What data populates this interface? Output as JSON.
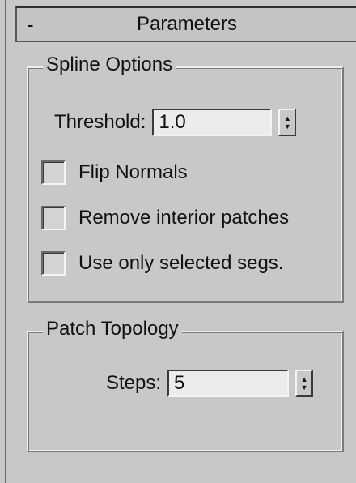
{
  "rollout": {
    "toggle": "-",
    "title": "Parameters"
  },
  "spline_options": {
    "legend": "Spline Options",
    "threshold_label": "Threshold:",
    "threshold_value": "1.0",
    "checkboxes": [
      {
        "label": "Flip Normals",
        "checked": false
      },
      {
        "label": "Remove interior patches",
        "checked": false
      },
      {
        "label": "Use only selected segs.",
        "checked": false
      }
    ]
  },
  "patch_topology": {
    "legend": "Patch Topology",
    "steps_label": "Steps:",
    "steps_value": "5"
  },
  "spinner_arrows": {
    "up": "▲",
    "down": "▼"
  }
}
